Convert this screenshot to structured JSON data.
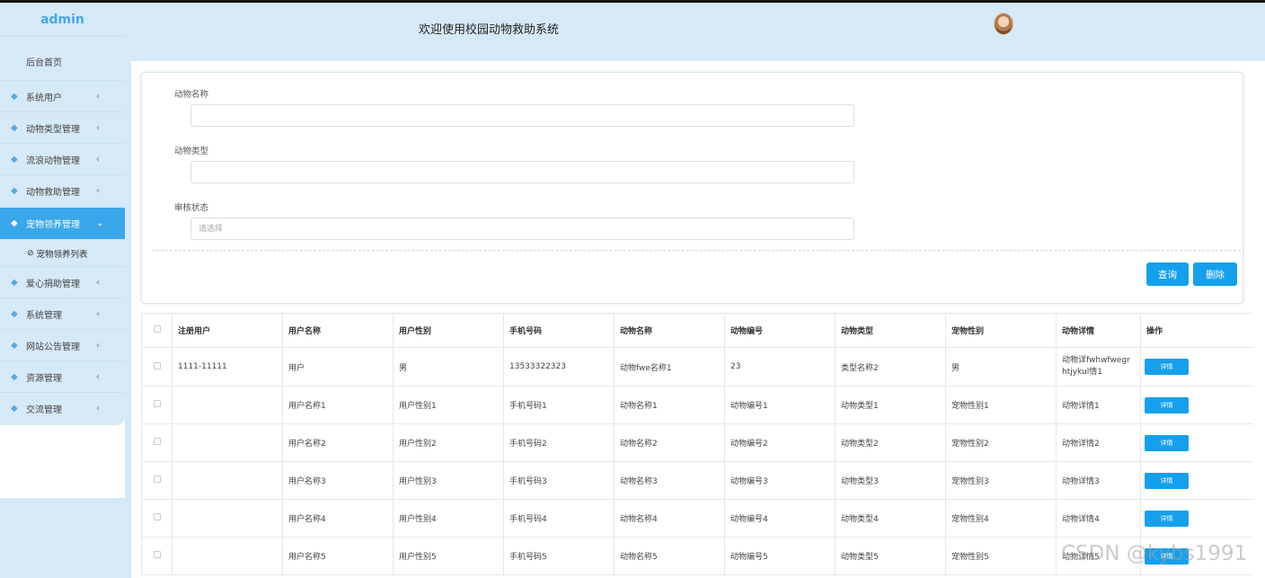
{
  "sidebar": {
    "brand": "admin",
    "home": "后台首页",
    "items": [
      {
        "label": "系统用户"
      },
      {
        "label": "动物类型管理"
      },
      {
        "label": "流浪动物管理"
      },
      {
        "label": "动物救助管理"
      },
      {
        "label": "宠物领养管理"
      },
      {
        "label": "爱心捐助管理"
      },
      {
        "label": "系统管理"
      },
      {
        "label": "网站公告管理"
      },
      {
        "label": "资源管理"
      },
      {
        "label": "交流管理"
      }
    ],
    "active_index": 4,
    "submenu": {
      "label": "宠物领养列表"
    }
  },
  "header": {
    "title": "欢迎使用校园动物救助系统"
  },
  "search": {
    "fields": [
      {
        "label": "动物名称",
        "value": "",
        "placeholder": ""
      },
      {
        "label": "动物类型",
        "value": "",
        "placeholder": ""
      },
      {
        "label": "审核状态",
        "value": "",
        "placeholder": "请选择"
      }
    ],
    "query_button": "查询",
    "delete_button": "删除"
  },
  "table": {
    "headers": [
      "注册用户",
      "用户名称",
      "用户性别",
      "手机号码",
      "动物名称",
      "动物编号",
      "动物类型",
      "宠物性别",
      "动物详情",
      "操作"
    ],
    "rows": [
      [
        "1111-11111",
        "用户",
        "男",
        "13533322323",
        "动物fwe名称1",
        "23",
        "类型名称2",
        "男",
        "动物详fwhwfwegrhtjykul情1"
      ],
      [
        "",
        "用户名称1",
        "用户性别1",
        "手机号码1",
        "动物名称1",
        "动物编号1",
        "动物类型1",
        "宠物性别1",
        "动物详情1"
      ],
      [
        "",
        "用户名称2",
        "用户性别2",
        "手机号码2",
        "动物名称2",
        "动物编号2",
        "动物类型2",
        "宠物性别2",
        "动物详情2"
      ],
      [
        "",
        "用户名称3",
        "用户性别3",
        "手机号码3",
        "动物名称3",
        "动物编号3",
        "动物类型3",
        "宠物性别3",
        "动物详情3"
      ],
      [
        "",
        "用户名称4",
        "用户性别4",
        "手机号码4",
        "动物名称4",
        "动物编号4",
        "动物类型4",
        "宠物性别4",
        "动物详情4"
      ],
      [
        "",
        "用户名称5",
        "用户性别5",
        "手机号码5",
        "动物名称5",
        "动物编号5",
        "动物类型5",
        "宠物性别5",
        "动物详情5"
      ]
    ],
    "detail_button": "详情"
  },
  "watermark": "CSDN @kybs1991",
  "colors": {
    "accent": "#14a0ec",
    "sidebar_bg": "#d6e9f6",
    "active": "#3aa7ea"
  }
}
